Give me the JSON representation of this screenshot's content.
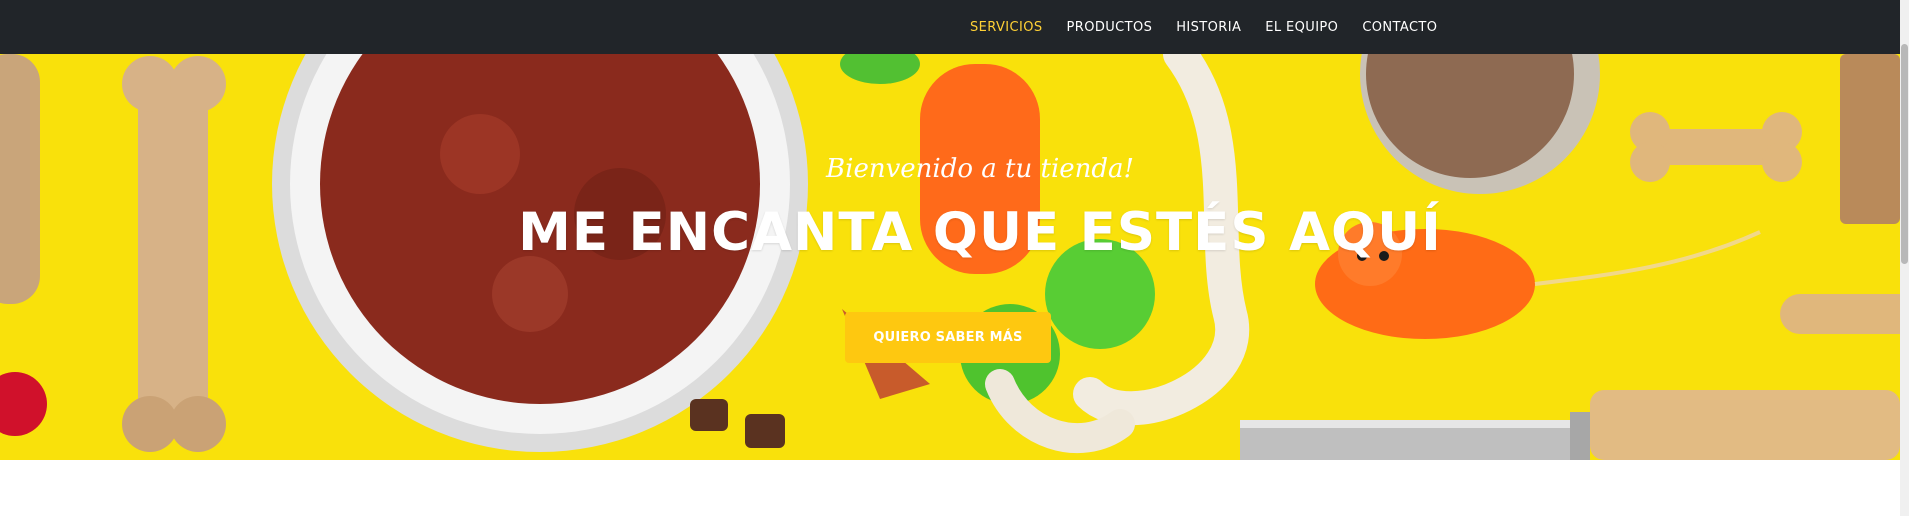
{
  "nav": {
    "items": [
      {
        "label": "SERVICIOS",
        "active": true
      },
      {
        "label": "PRODUCTOS"
      },
      {
        "label": "HISTORIA"
      },
      {
        "label": "EL EQUIPO"
      },
      {
        "label": "CONTACTO"
      }
    ]
  },
  "hero": {
    "subtitle": "Bienvenido a tu tienda!",
    "title": "ME ENCANTA QUE ESTÉS AQUÍ",
    "cta_label": "QUIERO SABER MÁS"
  },
  "colors": {
    "navbar_bg": "#212529",
    "nav_active": "#fed136",
    "hero_bg": "#f9e10b",
    "cta_bg": "#fec810"
  }
}
